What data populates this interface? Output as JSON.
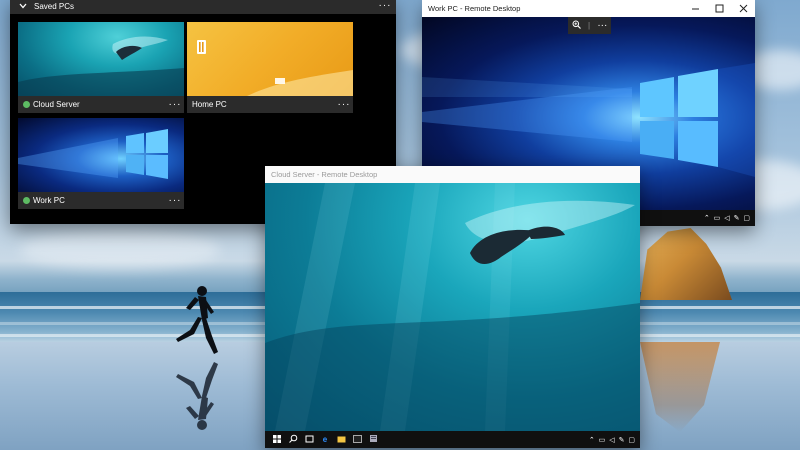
{
  "saved_pcs": {
    "header_title": "Saved PCs",
    "tiles": [
      {
        "name": "Cloud Server",
        "status": "online"
      },
      {
        "name": "Home PC",
        "status": "none"
      },
      {
        "name": "Work PC",
        "status": "online"
      }
    ]
  },
  "work_window": {
    "title": "Work PC - Remote Desktop"
  },
  "cloud_window": {
    "title": "Cloud Server - Remote Desktop"
  },
  "colors": {
    "online_dot": "#5dbb63",
    "tile_label_bg": "#2b2b2b",
    "taskbar_bg": "#101010"
  },
  "icons": {
    "more": "⋯",
    "chevron": "⌄",
    "zoom": "zoom-in-icon"
  }
}
